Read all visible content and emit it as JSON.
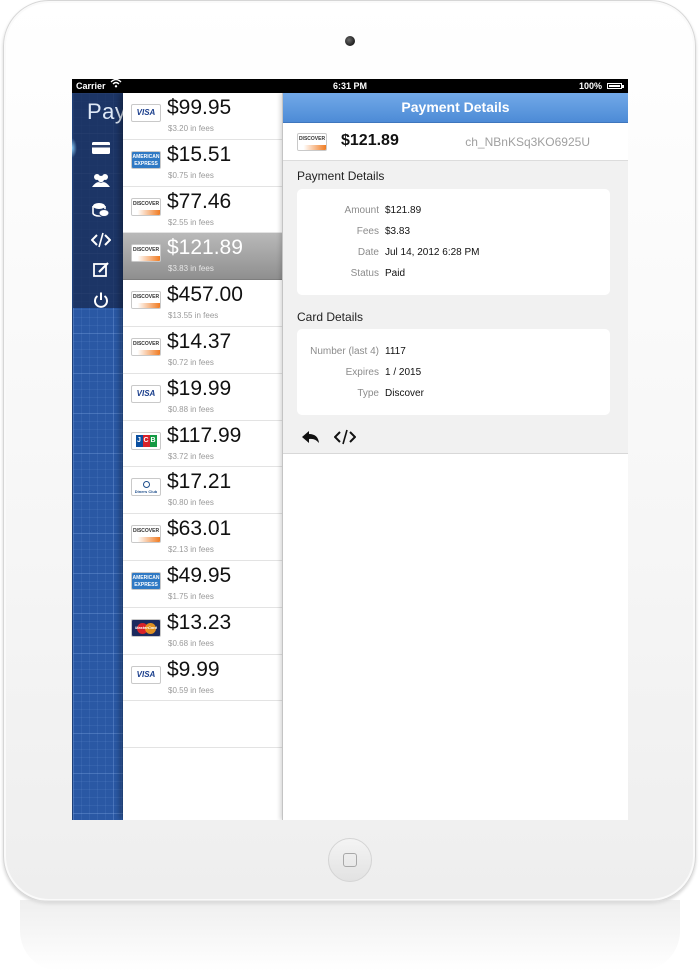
{
  "status_bar": {
    "carrier": "Carrier",
    "time": "6:31 PM",
    "battery": "100%",
    "battery_level": 1.0
  },
  "sidebar": {
    "title": "Pay",
    "items": [
      {
        "icon": "credit-card-icon",
        "active": true
      },
      {
        "icon": "customers-icon",
        "active": false
      },
      {
        "icon": "coins-icon",
        "active": false
      },
      {
        "icon": "code-icon",
        "active": false
      },
      {
        "icon": "compose-icon",
        "active": false
      },
      {
        "icon": "power-icon",
        "active": false
      }
    ]
  },
  "payments": [
    {
      "brand": "visa",
      "brand_label": "VISA",
      "amount": "$99.95",
      "fees": "$3.20 in fees"
    },
    {
      "brand": "amex",
      "brand_label": "AMERICAN EXPRESS",
      "amount": "$15.51",
      "fees": "$0.75 in fees"
    },
    {
      "brand": "discover",
      "brand_label": "DISCOVER",
      "amount": "$77.46",
      "fees": "$2.55 in fees"
    },
    {
      "brand": "discover",
      "brand_label": "DISCOVER",
      "amount": "$121.89",
      "fees": "$3.83 in fees",
      "selected": true
    },
    {
      "brand": "discover",
      "brand_label": "DISCOVER",
      "amount": "$457.00",
      "fees": "$13.55 in fees"
    },
    {
      "brand": "discover",
      "brand_label": "DISCOVER",
      "amount": "$14.37",
      "fees": "$0.72 in fees"
    },
    {
      "brand": "visa",
      "brand_label": "VISA",
      "amount": "$19.99",
      "fees": "$0.88 in fees"
    },
    {
      "brand": "jcb",
      "brand_label": "JCB",
      "amount": "$117.99",
      "fees": "$3.72 in fees"
    },
    {
      "brand": "diners",
      "brand_label": "Diners Club International",
      "amount": "$17.21",
      "fees": "$0.80 in fees"
    },
    {
      "brand": "discover",
      "brand_label": "DISCOVER",
      "amount": "$63.01",
      "fees": "$2.13 in fees"
    },
    {
      "brand": "amex",
      "brand_label": "AMERICAN EXPRESS",
      "amount": "$49.95",
      "fees": "$1.75 in fees"
    },
    {
      "brand": "mastercard",
      "brand_label": "MasterCard",
      "amount": "$13.23",
      "fees": "$0.68 in fees"
    },
    {
      "brand": "visa",
      "brand_label": "VISA",
      "amount": "$9.99",
      "fees": "$0.59 in fees"
    }
  ],
  "detail": {
    "nav_title": "Payment Details",
    "header": {
      "brand_label": "DISCOVER",
      "amount": "$121.89",
      "charge_id": "ch_NBnKSq3KO6925U"
    },
    "payment_section": {
      "title": "Payment Details",
      "fields": [
        {
          "label": "Amount",
          "value": "$121.89"
        },
        {
          "label": "Fees",
          "value": "$3.83"
        },
        {
          "label": "Date",
          "value": "Jul 14, 2012 6:28 PM"
        },
        {
          "label": "Status",
          "value": "Paid"
        }
      ]
    },
    "card_section": {
      "title": "Card Details",
      "fields": [
        {
          "label": "Number (last 4)",
          "value": "1117"
        },
        {
          "label": "Expires",
          "value": "1 / 2015"
        },
        {
          "label": "Type",
          "value": "Discover"
        }
      ]
    },
    "actions": [
      "reply-icon",
      "code-icon"
    ]
  },
  "colors": {
    "accent": "#5b97dd",
    "sidebar": "#2a58a4",
    "selected_row": "#9e9e9e"
  }
}
